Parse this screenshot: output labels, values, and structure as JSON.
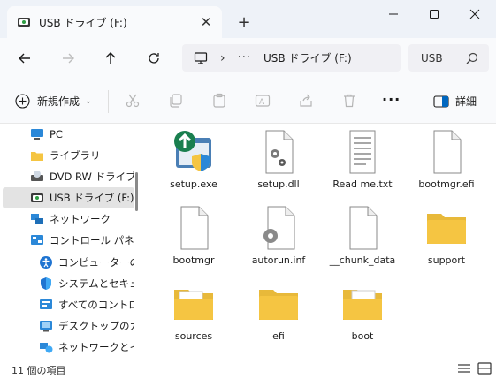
{
  "tab": {
    "title": "USB ドライブ (F:)",
    "close_glyph": "✕",
    "new_tab_glyph": "+"
  },
  "window": {
    "minimize_icon": "minimize-icon",
    "maximize_icon": "maximize-icon",
    "close_icon": "close-icon"
  },
  "address": {
    "more_glyph": "···",
    "separator": "›",
    "path": "USB ドライブ (F:)",
    "search_placeholder": "USB"
  },
  "toolbar": {
    "new_label": "新規作成",
    "new_chevron": "⌄",
    "more_glyph": "···",
    "details_label": "詳細"
  },
  "sidebar": {
    "items": [
      {
        "label": "PC",
        "icon": "pc-icon"
      },
      {
        "label": "ライブラリ",
        "icon": "library-folder-icon"
      },
      {
        "label": "DVD RW ドライブ (",
        "icon": "dvd-drive-icon"
      },
      {
        "label": "USB ドライブ (F:)",
        "icon": "usb-drive-icon",
        "selected": true
      },
      {
        "label": "ネットワーク",
        "icon": "network-icon"
      },
      {
        "label": "コントロール パネル",
        "icon": "control-panel-icon"
      },
      {
        "label": "コンピューターの簡",
        "icon": "accessibility-icon"
      },
      {
        "label": "システムとセキュリ",
        "icon": "security-shield-icon"
      },
      {
        "label": "すべてのコントロー",
        "icon": "all-control-panel-icon"
      },
      {
        "label": "デスクトップのカス",
        "icon": "desktop-customize-icon"
      },
      {
        "label": "ネットワークとイン",
        "icon": "network-internet-icon"
      }
    ]
  },
  "files": [
    {
      "name": "setup.exe",
      "icon": "setup-exe-icon"
    },
    {
      "name": "setup.dll",
      "icon": "dll-gear-icon"
    },
    {
      "name": "Read me.txt",
      "icon": "text-file-icon"
    },
    {
      "name": "bootmgr.efi",
      "icon": "blank-file-icon"
    },
    {
      "name": "bootmgr",
      "icon": "blank-file-icon"
    },
    {
      "name": "autorun.inf",
      "icon": "inf-gear-icon"
    },
    {
      "name": "__chunk_data",
      "icon": "blank-file-icon"
    },
    {
      "name": "support",
      "icon": "folder-icon"
    },
    {
      "name": "sources",
      "icon": "folder-with-files-icon"
    },
    {
      "name": "efi",
      "icon": "folder-icon"
    },
    {
      "name": "boot",
      "icon": "folder-with-files-icon"
    }
  ],
  "status": {
    "item_count": "11 個の項目"
  },
  "colors": {
    "folder": "#f5c542",
    "titlebar": "#eef2f8",
    "selected": "#e3e3e3",
    "accent": "#0067c0"
  }
}
